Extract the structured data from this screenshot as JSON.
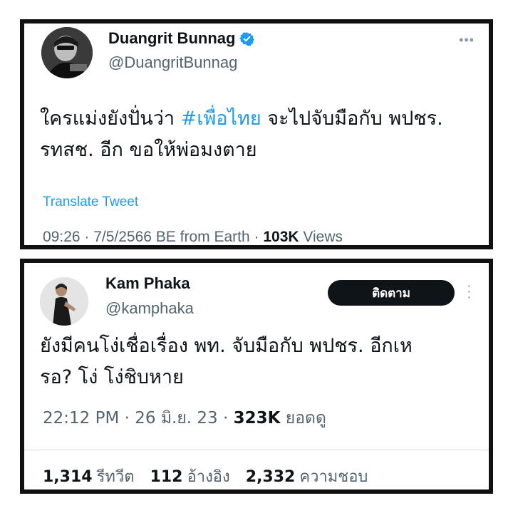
{
  "tweet1": {
    "display_name": "Duangrit Bunnag",
    "handle": "@DuangritBunnag",
    "verified": true,
    "text_line1_before": "ใครแม่งยังปั่นว่า ",
    "hashtag": "#เพื่อไทย",
    "text_line1_after": " จะไปจับมือกับ พปชร.",
    "text_line2": "รทสช. อีก ขอให้พ่อมงตาย",
    "translate_label": "Translate Tweet",
    "timestamp": "09:26 · 7/5/2566 BE from Earth · ",
    "views_count": "103K",
    "views_label": " Views",
    "more_icon": "more-horizontal-icon"
  },
  "tweet2": {
    "display_name": "Kam Phaka",
    "handle": "@kamphaka",
    "follow_label": "ติดตาม",
    "text_line1": "ยังมีคนโง่เชื่อเรื่อง พท. จับมือกับ พปชร. อีกเห",
    "text_line2": "รอ? โง่ โง่ชิบหาย",
    "timestamp": "22:12 PM · 26 มิ.ย. 23 · ",
    "views_count": "323K",
    "views_label": " ยอดดู",
    "retweets_count": "1,314",
    "retweets_label": "รีทวีต",
    "quotes_count": "112",
    "quotes_label": "อ้างอิง",
    "likes_count": "2,332",
    "likes_label": "ความชอบ",
    "more_icon": "more-vertical-icon"
  },
  "colors": {
    "link_blue": "#1d9bf0",
    "secondary_text": "#536471",
    "primary_text": "#0f1419",
    "border": "#111111"
  }
}
